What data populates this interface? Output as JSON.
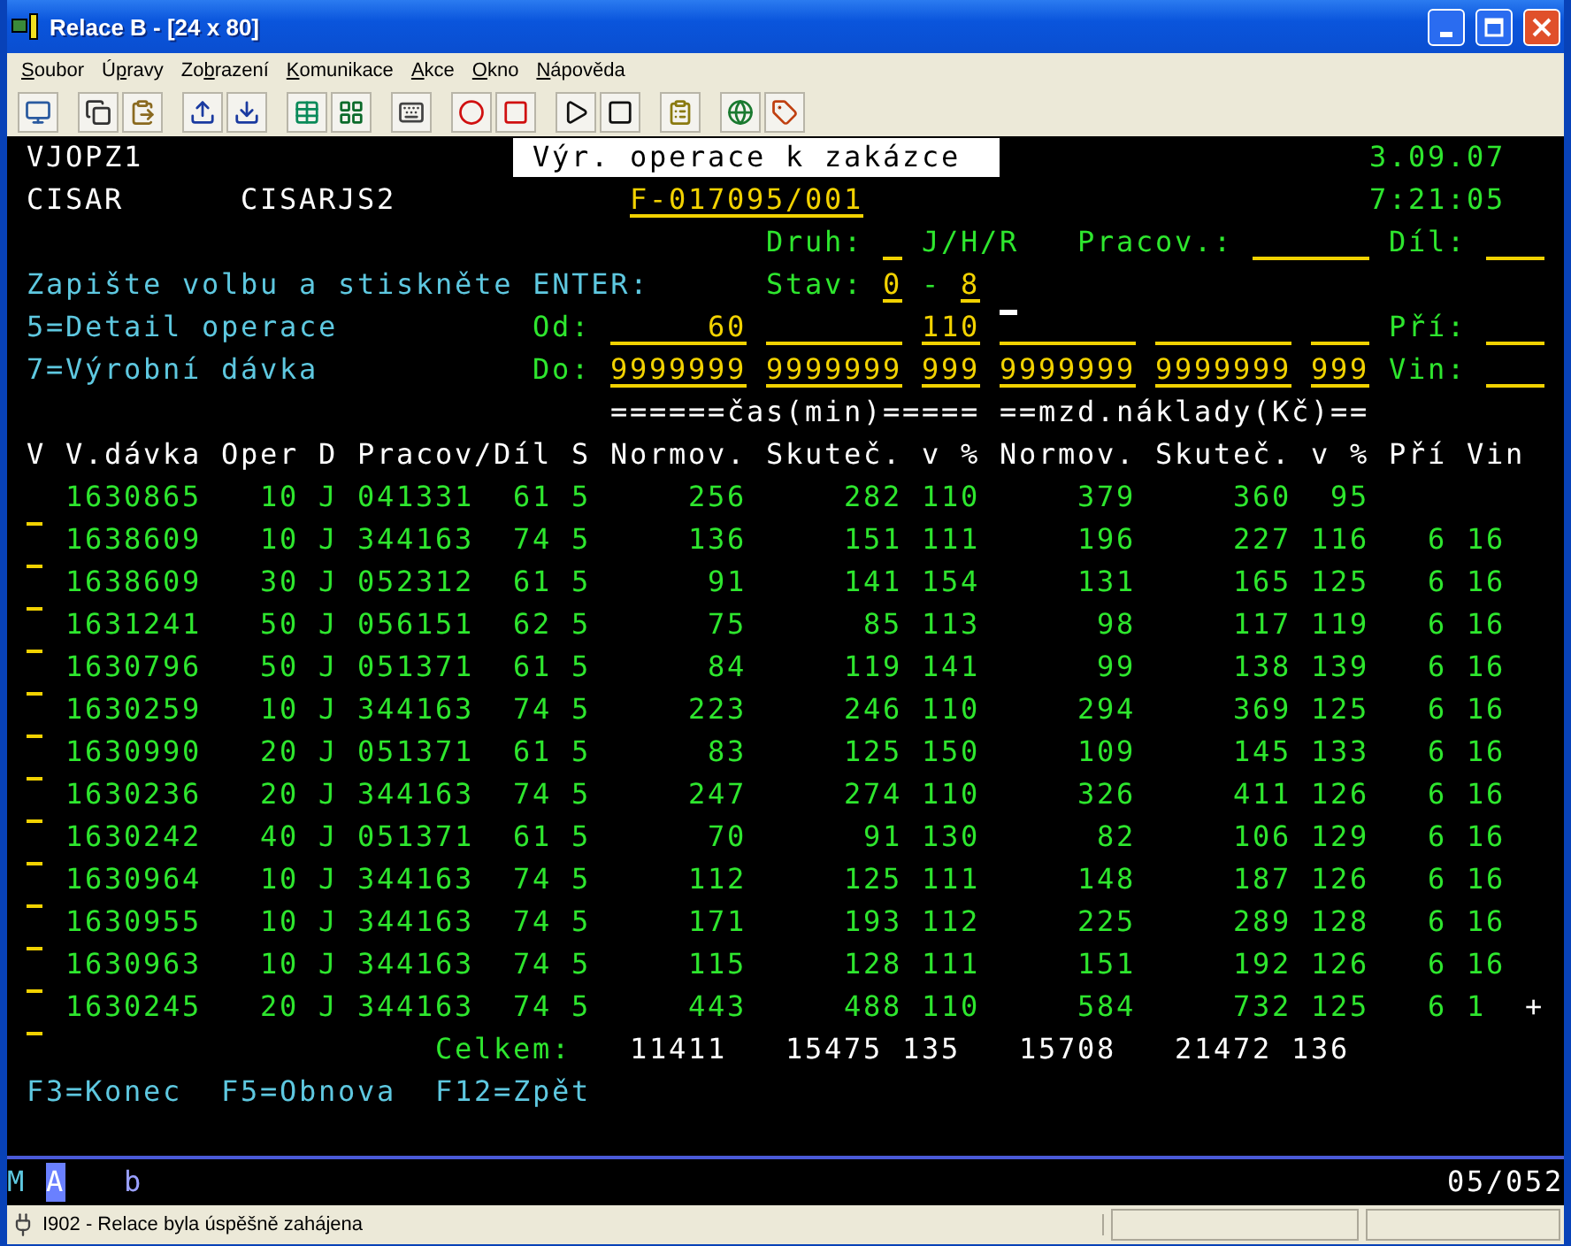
{
  "window": {
    "title": "Relace B - [24 x 80]"
  },
  "menu": [
    {
      "parts": [
        {
          "text": "S",
          "underlined": true
        },
        {
          "text": "oubor",
          "underlined": false
        }
      ]
    },
    {
      "parts": [
        {
          "text": "Ú",
          "underlined": false
        },
        {
          "text": "p",
          "underlined": true
        },
        {
          "text": "ravy",
          "underlined": false
        }
      ]
    },
    {
      "parts": [
        {
          "text": "Zo",
          "underlined": false
        },
        {
          "text": "b",
          "underlined": true
        },
        {
          "text": "razení",
          "underlined": false
        }
      ]
    },
    {
      "parts": [
        {
          "text": "K",
          "underlined": true
        },
        {
          "text": "omunikace",
          "underlined": false
        }
      ]
    },
    {
      "parts": [
        {
          "text": "A",
          "underlined": true
        },
        {
          "text": "kce",
          "underlined": false
        }
      ]
    },
    {
      "parts": [
        {
          "text": "O",
          "underlined": true
        },
        {
          "text": "kno",
          "underlined": false
        }
      ]
    },
    {
      "parts": [
        {
          "text": "N",
          "underlined": true
        },
        {
          "text": "ápověda",
          "underlined": false
        }
      ]
    }
  ],
  "header": {
    "program": "VJOPZ1",
    "title": "Výr. operace k zakázce",
    "date": "3.09.07",
    "user": "CISAR",
    "device": "CISARJS2",
    "order": "F-017095/001",
    "time": "7:21:05"
  },
  "filters": {
    "druh_label": "Druh:",
    "druh_hint": "J/H/R",
    "pracov_label": "Pracov.:",
    "dil_label": "Díl:",
    "instruction": "Zapište volbu a stiskněte ENTER:",
    "stav_label": "Stav:",
    "stav_from": "0",
    "stav_separator": "-",
    "stav_to": "8",
    "options": [
      "5=Detail operace",
      "7=Výrobní dávka"
    ],
    "pri_label": "Pří:",
    "vin_label": "Vin:"
  },
  "range": {
    "group_headers": [
      "======čas(min)=====",
      "==mzd.náklady(Kč)=="
    ],
    "from": {
      "label": "Od:",
      "fields": [
        {
          "value": "60",
          "cursor": false
        },
        {
          "cursor": false
        },
        {
          "value": "110",
          "cursor": false
        },
        {
          "cursor": true
        },
        {
          "cursor": false
        },
        {
          "cursor": false
        }
      ]
    },
    "to": {
      "label": "Do:",
      "fields": [
        {
          "value": "9999999",
          "cursor": false
        },
        {
          "value": "9999999",
          "cursor": false
        },
        {
          "value": "999",
          "cursor": false
        },
        {
          "value": "9999999",
          "cursor": false
        },
        {
          "value": "9999999",
          "cursor": false
        },
        {
          "value": "999",
          "cursor": false
        }
      ]
    }
  },
  "table": {
    "columns": [
      "V",
      "V.dávka",
      "Oper",
      "D",
      "Pracov/Díl",
      "S",
      "Normov.",
      "Skuteč.",
      "v %",
      "Normov.",
      "Skuteč.",
      "v %",
      "Pří",
      "Vin"
    ],
    "rows": [
      {
        "cells": [
          "",
          "1630865",
          "10",
          "J",
          "041331  61",
          "5",
          "256",
          "282",
          "110",
          "379",
          "360",
          "95"
        ]
      },
      {
        "cells": [
          "",
          "1638609",
          "10",
          "J",
          "344163  74",
          "5",
          "136",
          "151",
          "111",
          "196",
          "227",
          "116",
          "6",
          "16"
        ]
      },
      {
        "cells": [
          "",
          "1638609",
          "30",
          "J",
          "052312  61",
          "5",
          "91",
          "141",
          "154",
          "131",
          "165",
          "125",
          "6",
          "16"
        ]
      },
      {
        "cells": [
          "",
          "1631241",
          "50",
          "J",
          "056151  62",
          "5",
          "75",
          "85",
          "113",
          "98",
          "117",
          "119",
          "6",
          "16"
        ]
      },
      {
        "cells": [
          "",
          "1630796",
          "50",
          "J",
          "051371  61",
          "5",
          "84",
          "119",
          "141",
          "99",
          "138",
          "139",
          "6",
          "16"
        ]
      },
      {
        "cells": [
          "",
          "1630259",
          "10",
          "J",
          "344163  74",
          "5",
          "223",
          "246",
          "110",
          "294",
          "369",
          "125",
          "6",
          "16"
        ]
      },
      {
        "cells": [
          "",
          "1630990",
          "20",
          "J",
          "051371  61",
          "5",
          "83",
          "125",
          "150",
          "109",
          "145",
          "133",
          "6",
          "16"
        ]
      },
      {
        "cells": [
          "",
          "1630236",
          "20",
          "J",
          "344163  74",
          "5",
          "247",
          "274",
          "110",
          "326",
          "411",
          "126",
          "6",
          "16"
        ]
      },
      {
        "cells": [
          "",
          "1630242",
          "40",
          "J",
          "051371  61",
          "5",
          "70",
          "91",
          "130",
          "82",
          "106",
          "129",
          "6",
          "16"
        ]
      },
      {
        "cells": [
          "",
          "1630964",
          "10",
          "J",
          "344163  74",
          "5",
          "112",
          "125",
          "111",
          "148",
          "187",
          "126",
          "6",
          "16"
        ]
      },
      {
        "cells": [
          "",
          "1630955",
          "10",
          "J",
          "344163  74",
          "5",
          "171",
          "193",
          "112",
          "225",
          "289",
          "128",
          "6",
          "16"
        ]
      },
      {
        "cells": [
          "",
          "1630963",
          "10",
          "J",
          "344163  74",
          "5",
          "115",
          "128",
          "111",
          "151",
          "192",
          "126",
          "6",
          "16"
        ]
      },
      {
        "cells": [
          "",
          "1630245",
          "20",
          "J",
          "344163  74",
          "5",
          "443",
          "488",
          "110",
          "584",
          "732",
          "125",
          "6",
          "1"
        ]
      }
    ],
    "more": "+"
  },
  "totals": {
    "label": "Celkem:",
    "values": [
      "11411",
      "15475",
      "135",
      "15708",
      "21472",
      "136"
    ]
  },
  "function_keys": [
    "F3=Konec",
    "F5=Obnova",
    "F12=Zpět"
  ],
  "oia": {
    "indicator_1": "M",
    "indicator_2": "A",
    "input": "b",
    "position": "05/052"
  },
  "status_bar": {
    "message": "I902 - Relace byla úspěšně zahájena"
  }
}
